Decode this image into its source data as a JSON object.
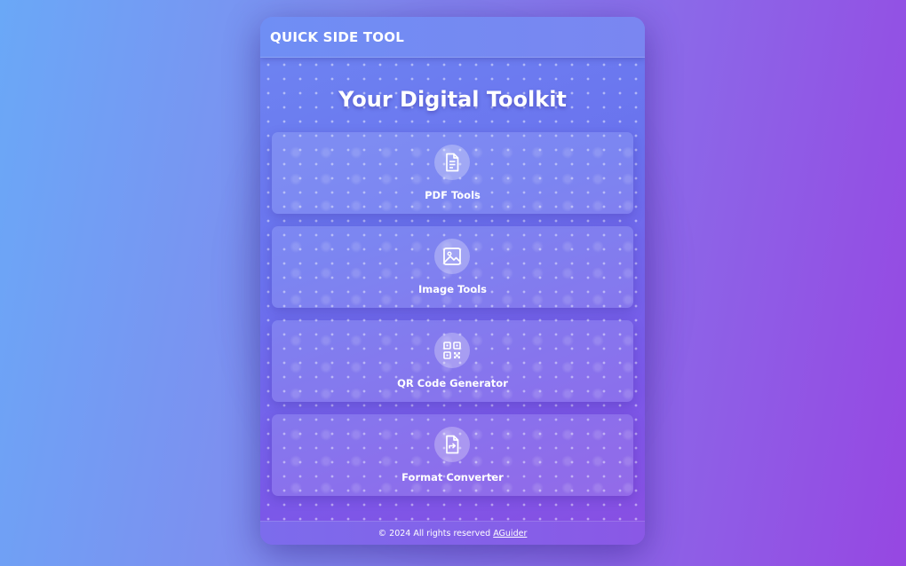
{
  "header": {
    "title": "QUICK SIDE TOOL"
  },
  "main": {
    "title": "Your Digital Toolkit",
    "tools": [
      {
        "label": "PDF Tools",
        "icon": "document-icon"
      },
      {
        "label": "Image Tools",
        "icon": "image-icon"
      },
      {
        "label": "QR Code Generator",
        "icon": "qr-code-icon"
      },
      {
        "label": "Format Converter",
        "icon": "file-convert-icon"
      }
    ]
  },
  "footer": {
    "copyright": "© 2024 All rights reserved",
    "link_text": "AGuider"
  },
  "colors": {
    "panel_start": "#6e86f2",
    "panel_end": "#8a4ee2",
    "text": "#ffffff"
  }
}
